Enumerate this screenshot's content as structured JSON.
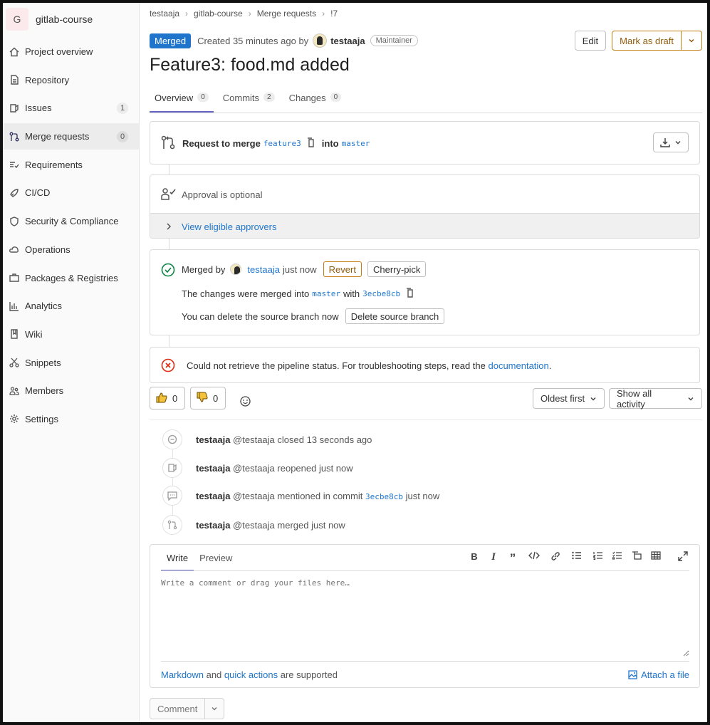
{
  "sidebar": {
    "project_initial": "G",
    "project_name": "gitlab-course",
    "items": [
      {
        "label": "Project overview"
      },
      {
        "label": "Repository"
      },
      {
        "label": "Issues",
        "count": "1"
      },
      {
        "label": "Merge requests",
        "count": "0"
      },
      {
        "label": "Requirements"
      },
      {
        "label": "CI/CD"
      },
      {
        "label": "Security & Compliance"
      },
      {
        "label": "Operations"
      },
      {
        "label": "Packages & Registries"
      },
      {
        "label": "Analytics"
      },
      {
        "label": "Wiki"
      },
      {
        "label": "Snippets"
      },
      {
        "label": "Members"
      },
      {
        "label": "Settings"
      }
    ]
  },
  "breadcrumb": [
    "testaaja",
    "gitlab-course",
    "Merge requests",
    "!7"
  ],
  "header": {
    "status": "Merged",
    "created_text": "Created 35 minutes ago by",
    "author": "testaaja",
    "role": "Maintainer",
    "edit": "Edit",
    "mark_draft": "Mark as draft"
  },
  "title": "Feature3: food.md added",
  "tabs": [
    {
      "label": "Overview",
      "count": "0"
    },
    {
      "label": "Commits",
      "count": "2"
    },
    {
      "label": "Changes",
      "count": "0"
    }
  ],
  "merge_info": {
    "request_to_merge": "Request to merge",
    "source": "feature3",
    "into": "into",
    "target": "master"
  },
  "approval": {
    "text": "Approval is optional",
    "view_approvers": "View eligible approvers"
  },
  "merged": {
    "merged_by": "Merged by",
    "user": "testaaja",
    "when": "just now",
    "revert": "Revert",
    "cherry_pick": "Cherry-pick",
    "changes_text": "The changes were merged into",
    "branch": "master",
    "with": "with",
    "commit": "3ecbe8cb",
    "delete_text": "You can delete the source branch now",
    "delete_button": "Delete source branch"
  },
  "pipeline": {
    "text": "Could not retrieve the pipeline status. For troubleshooting steps, read the",
    "link": "documentation",
    "period": "."
  },
  "reactions": {
    "thumbs_up": "0",
    "thumbs_down": "0"
  },
  "filters": {
    "sort": "Oldest first",
    "activity": "Show all activity"
  },
  "activity": [
    {
      "user": "testaaja",
      "handle": "@testaaja",
      "text": "closed 13 seconds ago"
    },
    {
      "user": "testaaja",
      "handle": "@testaaja",
      "text": "reopened just now"
    },
    {
      "user": "testaaja",
      "handle": "@testaaja",
      "text": "mentioned in commit",
      "commit": "3ecbe8cb",
      "tail": "just now"
    },
    {
      "user": "testaaja",
      "handle": "@testaaja",
      "text": "merged just now"
    }
  ],
  "editor": {
    "write": "Write",
    "preview": "Preview",
    "placeholder": "Write a comment or drag your files here…",
    "markdown": "Markdown",
    "and": "and",
    "quick_actions": "quick actions",
    "supported": "are supported",
    "attach": "Attach a file"
  },
  "comment_button": "Comment"
}
